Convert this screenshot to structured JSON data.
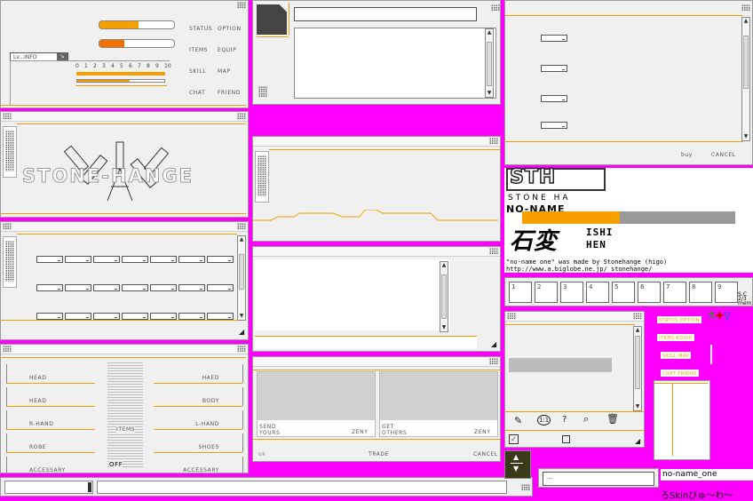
{
  "status_window": {
    "info_tab": "Lv...INFO",
    "scale": [
      "0",
      "1",
      "2",
      "3",
      "4",
      "5",
      "6",
      "7",
      "8",
      "9",
      "10"
    ],
    "menu": [
      "STATUS",
      "OPTION",
      "ITEMS",
      "EQUIP",
      "SKILL",
      "MAP",
      "CHAT",
      "FRIEND"
    ]
  },
  "logo": {
    "text": "STONE-HANGE"
  },
  "equip": {
    "left": [
      "HEAD",
      "HEAD",
      "R-HAND",
      "ROBE",
      "ACCESSARY"
    ],
    "right": [
      "HAED",
      "BODY",
      "L-HAND",
      "SHOES",
      "ACCESSARY"
    ],
    "center_label": "ITEMS",
    "off_label": "OFF"
  },
  "trade": {
    "send_label": "SEND\nYOURS",
    "get_label": "GET\nOTHERS",
    "zeny": "ZENY",
    "ok": "ok",
    "trade": "TRADE",
    "cancel": "CANCEL"
  },
  "shop": {
    "buy": "buy",
    "cancel": "CANCEL"
  },
  "credits": {
    "logo": "STH",
    "sub": "STONE HA",
    "noname": "NO-NAME",
    "ishi": "ISHI",
    "hen": "HEN",
    "kanji": "石変",
    "made_by": "\"no-name one\" was made by Stonehange (higo)",
    "url": "http://www.a.biglobe.ne.jp/ stonehange/"
  },
  "hotkeys": [
    "1",
    "2",
    "3",
    "4",
    "5",
    "6",
    "7",
    "8",
    "9"
  ],
  "hotkey_side": "S.C\n2/3\nmem",
  "right_menu": [
    "STATUS OPTION",
    "ITEMS EQUIP",
    "SKILL MAP",
    "CHAT FRIEND"
  ],
  "skin_name": "no-name_one",
  "skin_footer": "ろSkinびゅ〜わ〜",
  "mini_input": "...",
  "colors": {
    "accent": "#f5a000",
    "bg": "#ff00ff"
  }
}
